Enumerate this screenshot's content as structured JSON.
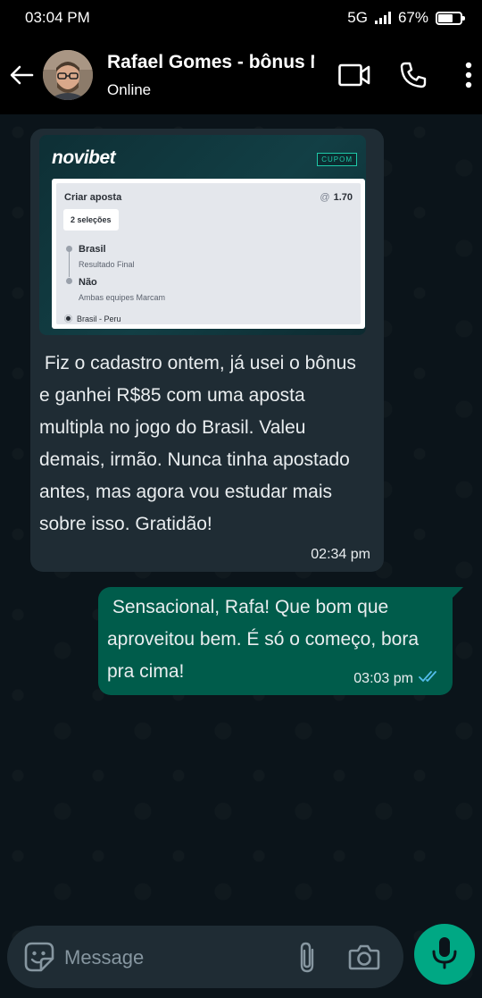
{
  "status_bar": {
    "time": "03:04 PM",
    "network": "5G",
    "battery": "67%",
    "battery_level": 0.67
  },
  "header": {
    "contact_name": "Rafael Gomes - bônus Novibet",
    "contact_status": "Online",
    "icons": [
      "back-arrow-icon",
      "video-call-icon",
      "voice-call-icon",
      "more-options-icon"
    ]
  },
  "messages": [
    {
      "direction": "incoming",
      "coupon": {
        "brand": "novibet",
        "tag": "CUPOM",
        "title": "Criar aposta",
        "odds_symbol": "@",
        "odds": "1.70",
        "selections_label": "2 seleções",
        "legs": [
          {
            "pick": "Brasil",
            "market": "Resultado Final"
          },
          {
            "pick": "Não",
            "market": "Ambas equipes Marcam"
          }
        ],
        "match": "Brasil  -  Peru"
      },
      "text": " Fiz o cadastro ontem, já usei o bônus e ganhei R$85 com uma aposta multipla no jogo do Brasil. Valeu demais, irmão. Nunca tinha apostado antes, mas agora vou estudar mais sobre isso. Gratidão!",
      "time": "02:34 pm"
    },
    {
      "direction": "outgoing",
      "text": " Sensacional, Rafa! Que bom que aproveitou bem. É só o começo, bora pra cima!",
      "time": "03:03 pm",
      "receipt": "read"
    }
  ],
  "composer": {
    "placeholder": "Message",
    "icons": [
      "emoji-sticker-icon",
      "attach-icon",
      "camera-icon",
      "microphone-icon"
    ]
  },
  "colors": {
    "app_background": "#0b141a",
    "incoming_bubble": "#1f2c34",
    "outgoing_bubble": "#005c4b",
    "accent": "#00a884",
    "read_ticks": "#53bdeb"
  }
}
